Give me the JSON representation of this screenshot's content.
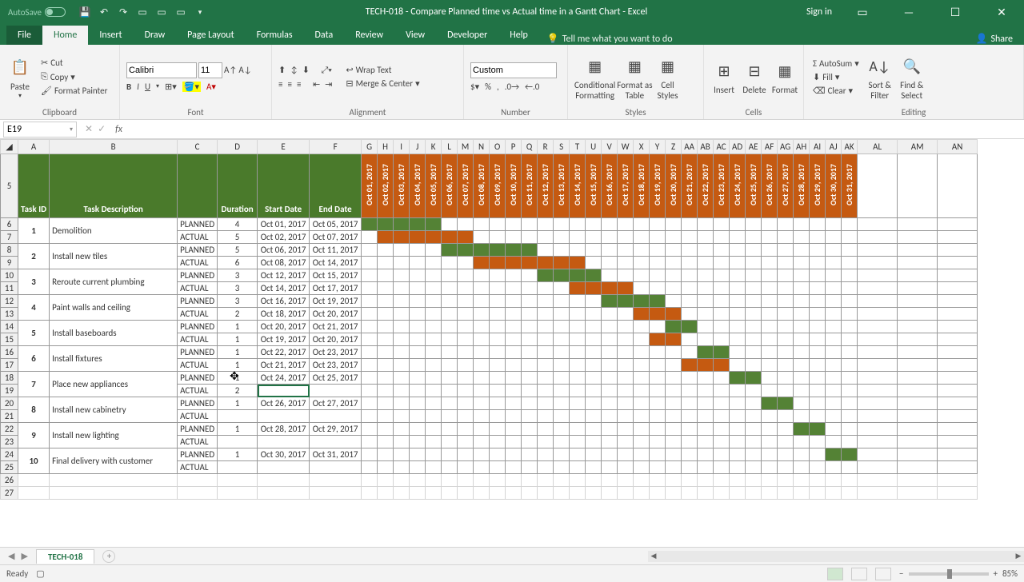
{
  "titlebar": {
    "autosave": "AutoSave",
    "title": "TECH-018 - Compare Planned time vs Actual time in a Gantt Chart  -  Excel",
    "signin": "Sign in"
  },
  "tabs": [
    "File",
    "Home",
    "Insert",
    "Draw",
    "Page Layout",
    "Formulas",
    "Data",
    "Review",
    "View",
    "Developer",
    "Help"
  ],
  "tell": "Tell me what you want to do",
  "share": "Share",
  "ribbon": {
    "clipboard": {
      "cut": "Cut",
      "copy": "Copy",
      "fp": "Format Painter",
      "paste": "Paste",
      "label": "Clipboard"
    },
    "font": {
      "name": "Calibri",
      "size": "11",
      "label": "Font"
    },
    "align": {
      "wrap": "Wrap Text",
      "merge": "Merge & Center",
      "label": "Alignment"
    },
    "number": {
      "fmt": "Custom",
      "label": "Number"
    },
    "styles": {
      "cf": "Conditional\nFormatting",
      "fat": "Format as\nTable",
      "cs": "Cell\nStyles",
      "label": "Styles"
    },
    "cells": {
      "ins": "Insert",
      "del": "Delete",
      "fmt": "Format",
      "label": "Cells"
    },
    "editing": {
      "sum": "AutoSum",
      "fill": "Fill",
      "clear": "Clear",
      "sort": "Sort &\nFilter",
      "find": "Find &\nSelect",
      "label": "Editing"
    }
  },
  "namebox": "E19",
  "cols": [
    "A",
    "B",
    "C",
    "D",
    "E",
    "F",
    "G",
    "H",
    "I",
    "J",
    "K",
    "L",
    "M",
    "N",
    "O",
    "P",
    "Q",
    "R",
    "S",
    "T",
    "U",
    "V",
    "W",
    "X",
    "Y",
    "Z",
    "AA",
    "AB",
    "AC",
    "AD",
    "AE",
    "AF",
    "AG",
    "AH",
    "AI",
    "AJ",
    "AK",
    "AL",
    "AM",
    "AN"
  ],
  "header": {
    "tid": "Task ID",
    "desc": "Task Description",
    "dur": "Duration",
    "sd": "Start Date",
    "ed": "End Date"
  },
  "dates": [
    "Oct 01, 2017",
    "Oct 02, 2017",
    "Oct 03, 2017",
    "Oct 04, 2017",
    "Oct 05, 2017",
    "Oct 06, 2017",
    "Oct 07, 2017",
    "Oct 08, 2017",
    "Oct 09, 2017",
    "Oct 10, 2017",
    "Oct 11, 2017",
    "Oct 12, 2017",
    "Oct 13, 2017",
    "Oct 14, 2017",
    "Oct 15, 2017",
    "Oct 16, 2017",
    "Oct 17, 2017",
    "Oct 18, 2017",
    "Oct 19, 2017",
    "Oct 20, 2017",
    "Oct 21, 2017",
    "Oct 22, 2017",
    "Oct 23, 2017",
    "Oct 24, 2017",
    "Oct 25, 2017",
    "Oct 26, 2017",
    "Oct 27, 2017",
    "Oct 28, 2017",
    "Oct 29, 2017",
    "Oct 30, 2017",
    "Oct 31, 2017"
  ],
  "rows": [
    {
      "r": 6,
      "tid": "1",
      "desc": "Demolition",
      "type": "PLANNED",
      "dur": "4",
      "sd": "Oct 01, 2017",
      "ed": "Oct 05, 2017",
      "g": [
        0,
        1,
        2,
        3,
        4
      ]
    },
    {
      "r": 7,
      "type": "ACTUAL",
      "dur": "5",
      "sd": "Oct 02, 2017",
      "ed": "Oct 07, 2017",
      "o": [
        1,
        2,
        3,
        4,
        5,
        6
      ]
    },
    {
      "r": 8,
      "tid": "2",
      "desc": "Install new tiles",
      "type": "PLANNED",
      "dur": "5",
      "sd": "Oct 06, 2017",
      "ed": "Oct 11, 2017",
      "g": [
        5,
        6,
        7,
        8,
        9,
        10
      ]
    },
    {
      "r": 9,
      "type": "ACTUAL",
      "dur": "6",
      "sd": "Oct 08, 2017",
      "ed": "Oct 14, 2017",
      "o": [
        7,
        8,
        9,
        10,
        11,
        12,
        13
      ]
    },
    {
      "r": 10,
      "tid": "3",
      "desc": "Reroute current plumbing",
      "type": "PLANNED",
      "dur": "3",
      "sd": "Oct 12, 2017",
      "ed": "Oct 15, 2017",
      "g": [
        11,
        12,
        13,
        14
      ]
    },
    {
      "r": 11,
      "type": "ACTUAL",
      "dur": "3",
      "sd": "Oct 14, 2017",
      "ed": "Oct 17, 2017",
      "o": [
        13,
        14,
        15,
        16
      ]
    },
    {
      "r": 12,
      "tid": "4",
      "desc": "Paint walls and ceiling",
      "type": "PLANNED",
      "dur": "3",
      "sd": "Oct 16, 2017",
      "ed": "Oct 19, 2017",
      "g": [
        15,
        16,
        17,
        18
      ]
    },
    {
      "r": 13,
      "type": "ACTUAL",
      "dur": "2",
      "sd": "Oct 18, 2017",
      "ed": "Oct 20, 2017",
      "o": [
        17,
        18,
        19
      ]
    },
    {
      "r": 14,
      "tid": "5",
      "desc": "Install baseboards",
      "type": "PLANNED",
      "dur": "1",
      "sd": "Oct 20, 2017",
      "ed": "Oct 21, 2017",
      "g": [
        19,
        20
      ]
    },
    {
      "r": 15,
      "type": "ACTUAL",
      "dur": "1",
      "sd": "Oct 19, 2017",
      "ed": "Oct 20, 2017",
      "o": [
        18,
        19
      ]
    },
    {
      "r": 16,
      "tid": "6",
      "desc": "Install fixtures",
      "type": "PLANNED",
      "dur": "1",
      "sd": "Oct 22, 2017",
      "ed": "Oct 23, 2017",
      "g": [
        21,
        22
      ]
    },
    {
      "r": 17,
      "type": "ACTUAL",
      "dur": "1",
      "sd": "Oct 21, 2017",
      "ed": "Oct 23, 2017",
      "o": [
        20,
        21,
        22
      ]
    },
    {
      "r": 18,
      "tid": "7",
      "desc": "Place new appliances",
      "type": "PLANNED",
      "dur": "1",
      "sd": "Oct 24, 2017",
      "ed": "Oct 25, 2017",
      "g": [
        23,
        24
      ]
    },
    {
      "r": 19,
      "type": "ACTUAL",
      "dur": "2",
      "sd": "",
      "ed": "",
      "sel": true
    },
    {
      "r": 20,
      "tid": "8",
      "desc": "Install new cabinetry",
      "type": "PLANNED",
      "dur": "1",
      "sd": "Oct 26, 2017",
      "ed": "Oct 27, 2017",
      "g": [
        25,
        26
      ]
    },
    {
      "r": 21,
      "type": "ACTUAL"
    },
    {
      "r": 22,
      "tid": "9",
      "desc": "Install new lighting",
      "type": "PLANNED",
      "dur": "1",
      "sd": "Oct 28, 2017",
      "ed": "Oct 29, 2017",
      "g": [
        27,
        28
      ]
    },
    {
      "r": 23,
      "type": "ACTUAL"
    },
    {
      "r": 24,
      "tid": "10",
      "desc": "Final delivery with customer",
      "type": "PLANNED",
      "dur": "1",
      "sd": "Oct 30, 2017",
      "ed": "Oct 31, 2017",
      "g": [
        29,
        30
      ]
    },
    {
      "r": 25,
      "type": "ACTUAL"
    }
  ],
  "sheet": "TECH-018",
  "status": {
    "ready": "Ready",
    "zoom": "85%"
  }
}
